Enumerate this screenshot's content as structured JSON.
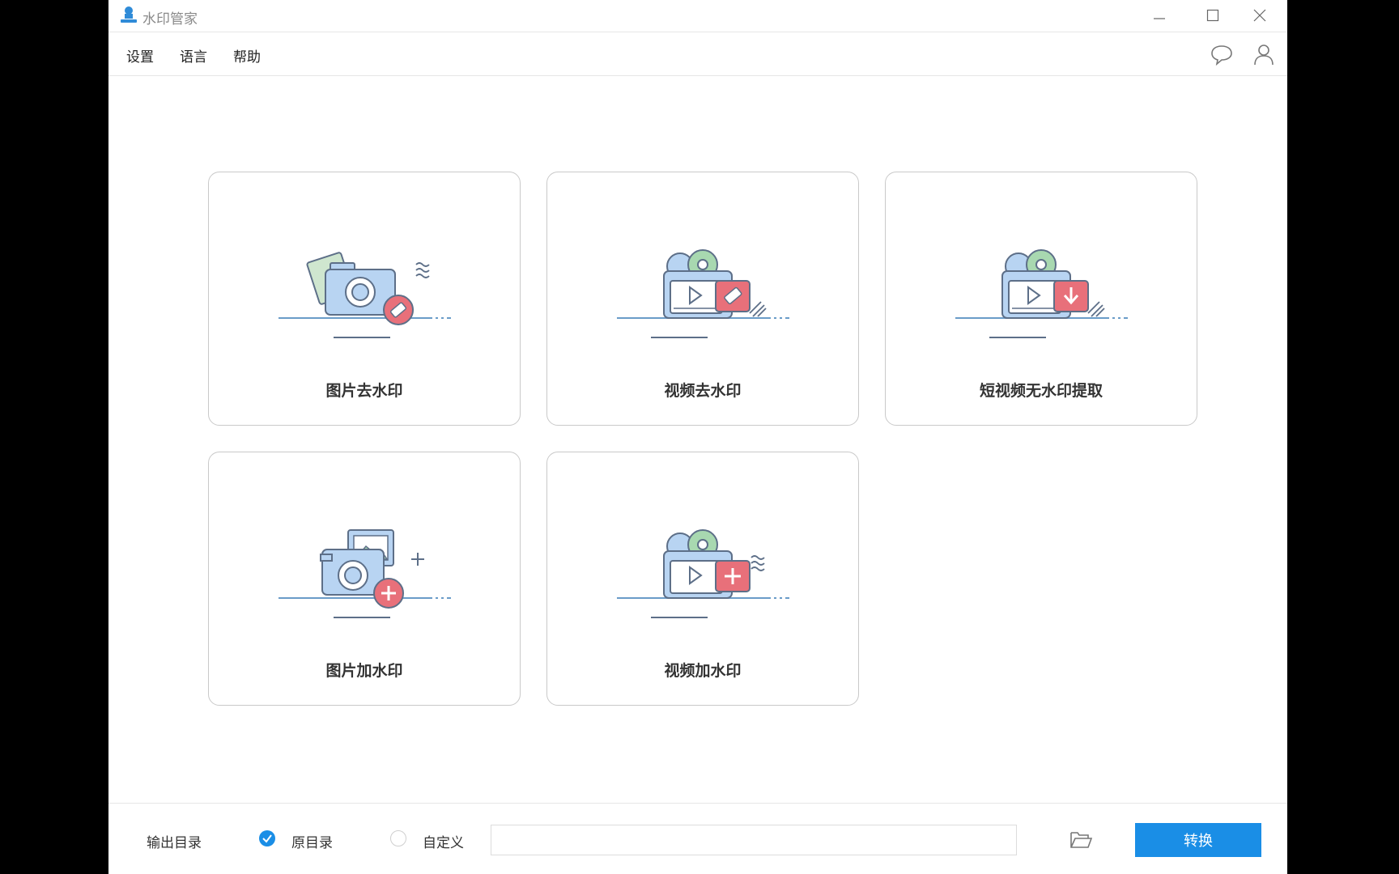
{
  "app": {
    "title": "水印管家"
  },
  "menu": {
    "items": [
      "设置",
      "语言",
      "帮助"
    ]
  },
  "cards": [
    {
      "label": "图片去水印",
      "icon": "camera-eraser-icon"
    },
    {
      "label": "视频去水印",
      "icon": "video-eraser-icon"
    },
    {
      "label": "短视频无水印提取",
      "icon": "video-download-icon"
    },
    {
      "label": "图片加水印",
      "icon": "camera-add-icon"
    },
    {
      "label": "视频加水印",
      "icon": "video-add-icon"
    }
  ],
  "footer": {
    "output_label": "输出目录",
    "options": [
      {
        "label": "原目录",
        "selected": true
      },
      {
        "label": "自定义",
        "selected": false
      }
    ],
    "path_value": "",
    "convert_label": "转换"
  },
  "colors": {
    "accent": "#1a8ee6",
    "icon_blue": "#b8d4f2",
    "icon_red": "#e8707a",
    "icon_green": "#a8d8b0"
  }
}
